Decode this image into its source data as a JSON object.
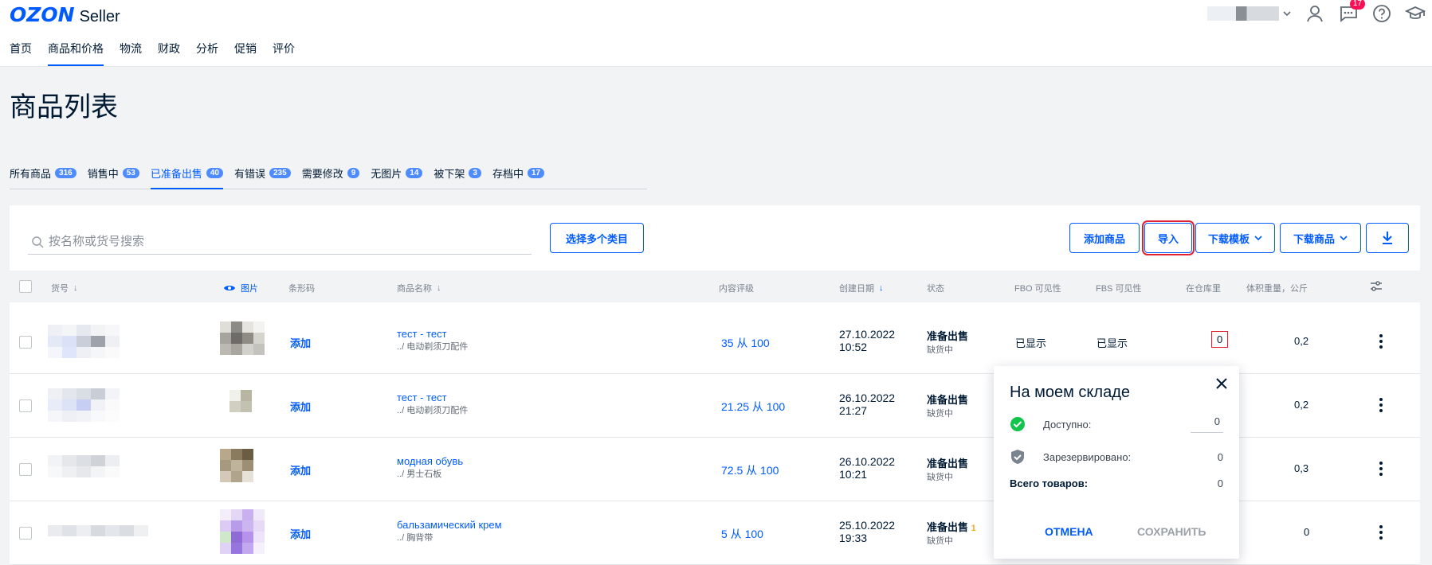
{
  "brand": {
    "logo": "OZON",
    "product": "Seller"
  },
  "header": {
    "notifications_count": "17"
  },
  "nav": [
    "首页",
    "商品和价格",
    "物流",
    "财政",
    "分析",
    "促销",
    "评价"
  ],
  "nav_active": 1,
  "page_title": "商品列表",
  "tabs": [
    {
      "label": "所有商品",
      "count": "316"
    },
    {
      "label": "销售中",
      "count": "53"
    },
    {
      "label": "已准备出售",
      "count": "40"
    },
    {
      "label": "有错误",
      "count": "235"
    },
    {
      "label": "需要修改",
      "count": "9"
    },
    {
      "label": "无图片",
      "count": "14"
    },
    {
      "label": "被下架",
      "count": "3"
    },
    {
      "label": "存档中",
      "count": "17"
    }
  ],
  "search": {
    "placeholder": "按名称或货号搜索"
  },
  "buttons": {
    "select_categories": "选择多个类目",
    "add_product": "添加商品",
    "import": "导入",
    "download_template": "下载模板",
    "download_products": "下载商品"
  },
  "columns": {
    "sku": "货号",
    "image": "图片",
    "barcode": "条形码",
    "name": "商品名称",
    "rating": "内容评级",
    "created": "创建日期",
    "status": "状态",
    "fbo": "FBO 可见性",
    "fbs": "FBS 可见性",
    "warehouse": "在仓库里",
    "volume": "体积重量，公斤"
  },
  "rows": [
    {
      "barcode": "添加",
      "name": "тест - тест",
      "category": "../ 电动剃须刀配件",
      "rating": "35 从 100",
      "date": "27.10.2022",
      "time": "10:52",
      "status": "准备出售",
      "stock": "缺货中",
      "fbo": "已显示",
      "fbs": "已显示",
      "warehouse": "0",
      "volume": "0,2"
    },
    {
      "barcode": "添加",
      "name": "тест - тест",
      "category": "../ 电动剃须刀配件",
      "rating": "21.25 从 100",
      "date": "26.10.2022",
      "time": "21:27",
      "status": "准备出售",
      "stock": "缺货中",
      "fbo": "",
      "fbs": "",
      "warehouse": "",
      "volume": "0,2"
    },
    {
      "barcode": "添加",
      "name": "модная обувь",
      "category": "../ 男士石板",
      "rating": "72.5 从 100",
      "date": "26.10.2022",
      "time": "10:21",
      "status": "准备出售",
      "stock": "缺货中",
      "fbo": "",
      "fbs": "",
      "warehouse": "",
      "volume": "0,3"
    },
    {
      "barcode": "添加",
      "name": "бальзамический крем",
      "category": "../ 胸背带",
      "rating": "5 从 100",
      "date": "25.10.2022",
      "time": "19:33",
      "status": "准备出售",
      "stock": "缺货中",
      "fbo": "",
      "fbs": "",
      "warehouse": "",
      "volume": "0"
    }
  ],
  "row4_tag": "1",
  "popup": {
    "title": "На моем складе",
    "available_label": "Доступно:",
    "available_value": "0",
    "reserved_label": "Зарезервировано:",
    "reserved_value": "0",
    "total_label": "Всего товаров:",
    "total_value": "0",
    "cancel": "ОТМЕНА",
    "save": "СОХРАНИТЬ"
  }
}
